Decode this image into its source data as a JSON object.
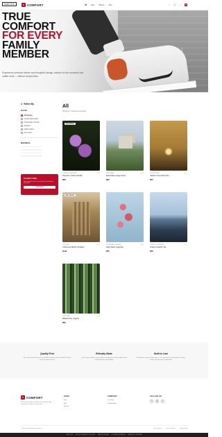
{
  "demo_badge": "DEMO SITE",
  "brand": {
    "mark": "C",
    "name": "COMFORT"
  },
  "nav": {
    "items": [
      "All",
      "New",
      "Women",
      "Men"
    ]
  },
  "hero": {
    "line1": "TRUE",
    "line2": "COMFORT",
    "line3": "FOR EVERY",
    "line4": "FAMILY",
    "line5": "MEMBER",
    "subtitle": "Experience premium fabrics and thoughtful design, tailored for the moments that matter most — without compromise."
  },
  "sidebar": {
    "filter_title": "Refine By",
    "category_label": "Gender",
    "categories": [
      "All Brands",
      "Comfort Essentials",
      "Sustainable Threads",
      "SoftForm",
      "Modern Basic",
      "Pure Wear"
    ],
    "material_label": "MATERIAL",
    "club": {
      "title": "Comfort Club",
      "text": "Get exclusive access to new drops and member-only offers.",
      "button": "JOIN NOW"
    }
  },
  "catalog": {
    "heading": "All",
    "count": "Showing 7 premium essentials",
    "products": [
      {
        "tag": "NEW ARRIVAL",
        "brand": "COMFORT ESSENTIALS",
        "rating": "★ 4.8",
        "name": "Premium Cotton Hoodie",
        "price": "$89"
      },
      {
        "tag": "",
        "brand": "PURE WEAR",
        "rating": "★ 4.6",
        "name": "Essential Lounge Pants",
        "price": "$65"
      },
      {
        "tag": "",
        "brand": "MODERN BASIC",
        "rating": "★ 4.7",
        "name": "Classic Crew Neck Tee",
        "price": "$35"
      },
      {
        "tag": "BEST SELLER",
        "brand": "SOFTFORM",
        "rating": "★ 4.9",
        "name": "Cashmere Blend Cardigan",
        "price": "$149"
      },
      {
        "tag": "",
        "brand": "SUSTAINABLE THREADS",
        "rating": "★ 4.5",
        "name": "High-Waist Leggings",
        "price": "$55"
      },
      {
        "tag": "",
        "brand": "COMFORT ESSENTIALS",
        "rating": "★ 4.7",
        "name": "Artisan Graphic Tee",
        "price": "$29"
      },
      {
        "tag": "",
        "brand": "PURE WEAR",
        "rating": "★ 4.6",
        "name": "Ribbed Knit Joggers",
        "price": "$59"
      }
    ]
  },
  "perks": [
    {
      "title": "Quality First",
      "text": "We source only the finest sustainable materials from certified mills and craft each piece to last."
    },
    {
      "title": "Ethically Made",
      "text": "Our factories adhere to the highest standards of worker welfare and environmental responsibility."
    },
    {
      "title": "Built to Last",
      "text": "We believe in fewer, better pieces. Our garments are designed to outlast trends and keep you comfortable."
    }
  ],
  "footer": {
    "description": "Premium everyday essentials for the whole family. Designed for comfort, made to last.",
    "shop": {
      "title": "SHOP",
      "items": [
        "New",
        "Men",
        "Women"
      ]
    },
    "company": {
      "title": "COMPANY",
      "items": [
        "Our Story",
        "Sustainability"
      ]
    },
    "follow": {
      "title": "FOLLOW US",
      "icons": [
        "f",
        "◎",
        "t"
      ]
    },
    "copyright": "© 2024 Comfort. All rights reserved.",
    "links": [
      "Privacy Policy",
      "Terms of Service",
      "Shipping Info"
    ]
  },
  "bottom_bar": [
    "DEMO SITE",
    "PRODUCTS ARE NOT FOR SALE",
    "MADE WITH CARE",
    "FOR DEMONSTRATION",
    "IMAGES BY UNSPLASH"
  ],
  "colors": {
    "accent": "#b8102a",
    "text": "#1a1a1a",
    "muted": "#777777"
  }
}
